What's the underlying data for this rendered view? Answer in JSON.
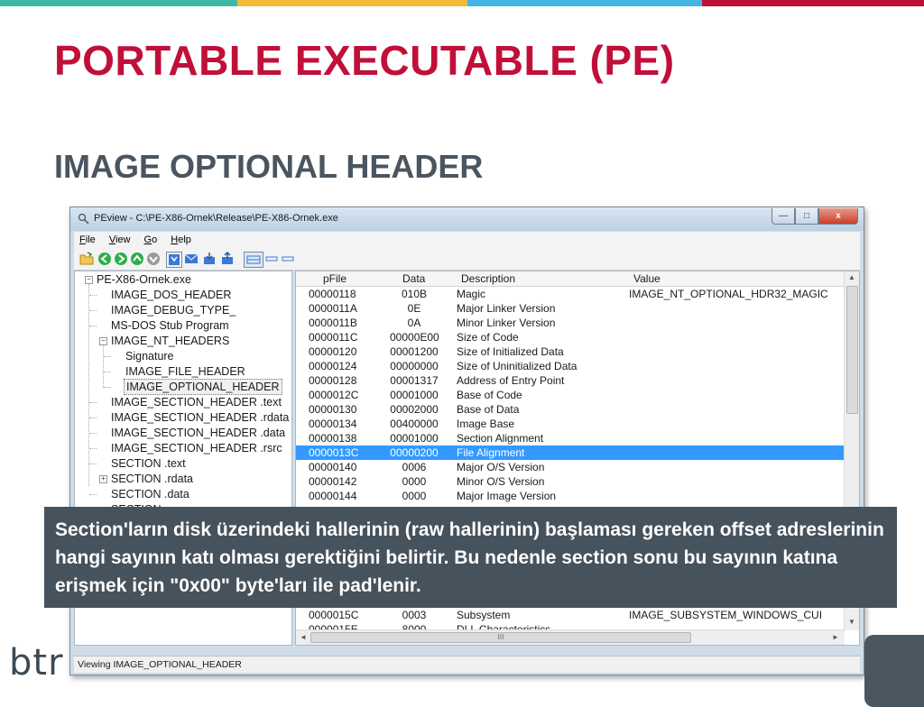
{
  "colors": {
    "stripe": [
      "#3db8a8",
      "#f2b935",
      "#42b4e6",
      "#c0103a"
    ],
    "title": "#c0103a",
    "subtitle": "#4a5560",
    "callout_bg": "#46525c",
    "selection": "#3399ff"
  },
  "slide": {
    "title": "PORTABLE EXECUTABLE (PE)",
    "subtitle": "IMAGE OPTIONAL HEADER",
    "logo": "btr"
  },
  "window": {
    "title": "PEview - C:\\PE-X86-Ornek\\Release\\PE-X86-Ornek.exe",
    "buttons": {
      "minimize": "—",
      "maximize": "□",
      "close": "x"
    },
    "menu": [
      "File",
      "View",
      "Go",
      "Help"
    ],
    "toolbar_icons": [
      "open-file-icon",
      "back-icon",
      "forward-icon",
      "up-icon",
      "down-icon",
      "save-icon",
      "mail-icon",
      "export-icon",
      "import-icon",
      "view-grid-icon",
      "view-list-icon",
      "view-detail-icon"
    ],
    "tree": [
      {
        "label": "PE-X86-Ornek.exe"
      },
      {
        "label": "IMAGE_DOS_HEADER"
      },
      {
        "label": "IMAGE_DEBUG_TYPE_"
      },
      {
        "label": "MS-DOS Stub Program"
      },
      {
        "label": "IMAGE_NT_HEADERS"
      },
      {
        "label": "Signature"
      },
      {
        "label": "IMAGE_FILE_HEADER"
      },
      {
        "label": "IMAGE_OPTIONAL_HEADER"
      },
      {
        "label": "IMAGE_SECTION_HEADER .text"
      },
      {
        "label": "IMAGE_SECTION_HEADER .rdata"
      },
      {
        "label": "IMAGE_SECTION_HEADER .data"
      },
      {
        "label": "IMAGE_SECTION_HEADER .rsrc"
      },
      {
        "label": "SECTION .text"
      },
      {
        "label": "SECTION .rdata"
      },
      {
        "label": "SECTION .data"
      },
      {
        "label": "SECTION .rsrc"
      }
    ],
    "columns": [
      "pFile",
      "Data",
      "Description",
      "Value"
    ],
    "rows": [
      [
        "00000118",
        "010B",
        "Magic",
        "IMAGE_NT_OPTIONAL_HDR32_MAGIC"
      ],
      [
        "0000011A",
        "0E",
        "Major Linker Version",
        ""
      ],
      [
        "0000011B",
        "0A",
        "Minor Linker Version",
        ""
      ],
      [
        "0000011C",
        "00000E00",
        "Size of Code",
        ""
      ],
      [
        "00000120",
        "00001200",
        "Size of Initialized Data",
        ""
      ],
      [
        "00000124",
        "00000000",
        "Size of Uninitialized Data",
        ""
      ],
      [
        "00000128",
        "00001317",
        "Address of Entry Point",
        ""
      ],
      [
        "0000012C",
        "00001000",
        "Base of Code",
        ""
      ],
      [
        "00000130",
        "00002000",
        "Base of Data",
        ""
      ],
      [
        "00000134",
        "00400000",
        "Image Base",
        ""
      ],
      [
        "00000138",
        "00001000",
        "Section Alignment",
        ""
      ],
      [
        "0000013C",
        "00000200",
        "File Alignment",
        ""
      ],
      [
        "00000140",
        "0006",
        "Major O/S Version",
        ""
      ],
      [
        "00000142",
        "0000",
        "Minor O/S Version",
        ""
      ],
      [
        "00000144",
        "0000",
        "Major Image Version",
        ""
      ],
      [
        "0000015C",
        "0003",
        "Subsystem",
        "IMAGE_SUBSYSTEM_WINDOWS_CUI"
      ],
      [
        "0000015E",
        "8000",
        "DLL Characteristics",
        ""
      ]
    ],
    "selected_row": 11,
    "hscroll_label": "III",
    "status": "Viewing IMAGE_OPTIONAL_HEADER"
  },
  "callout": {
    "text": "Section'ların disk üzerindeki  hallerinin (raw hallerinin) başlaması gereken offset adreslerinin hangi sayının katı olması gerektiğini belirtir. Bu nedenle section sonu bu sayının katına erişmek için \"0x00\" byte'ları ile pad'lenir."
  }
}
